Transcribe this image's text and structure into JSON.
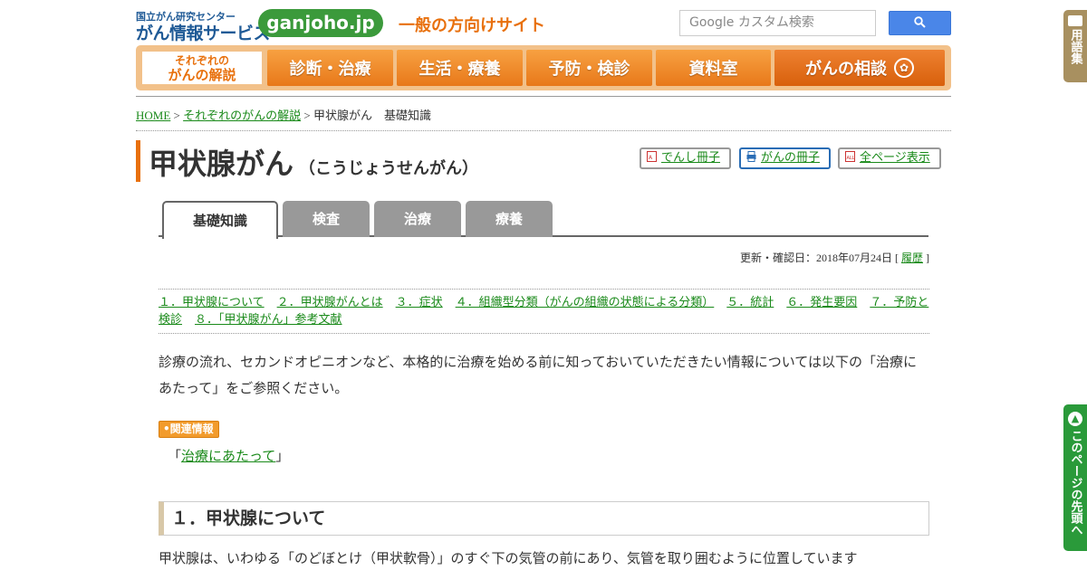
{
  "header": {
    "org": "国立がん研究センター",
    "service": "がん情報サービス",
    "domain": "ganjoho.jp",
    "tagline": "一般の方向けサイト",
    "search_placeholder": "Google カスタム検索"
  },
  "nav": {
    "active_l1": "それぞれの",
    "active_l2": "がんの解説",
    "items": [
      "診断・治療",
      "生活・療養",
      "予防・検診",
      "資料室",
      "がんの相談"
    ]
  },
  "breadcrumb": {
    "home": "HOME",
    "sep": " > ",
    "parent": "それぞれのがんの解説",
    "current": "甲状腺がん　基礎知識"
  },
  "page": {
    "title": "甲状腺がん",
    "reading": "（こうじょうせんがん）"
  },
  "tools": {
    "ebook": "でんし冊子",
    "booklet": "がんの冊子",
    "allpages": "全ページ表示"
  },
  "tabs": [
    "基礎知識",
    "検査",
    "治療",
    "療養"
  ],
  "updated": {
    "label": "更新・確認日：2018年07月24日 [ ",
    "history": "履歴",
    "close": " ]"
  },
  "toc": [
    "１．甲状腺について",
    "２．甲状腺がんとは",
    "３．症状",
    "４．組織型分類（がんの組織の状態による分類）",
    "５．統計",
    "６．発生要因",
    "７．予防と検診",
    "８．「甲状腺がん」参考文献"
  ],
  "intro": "診療の流れ、セカンドオピニオンなど、本格的に治療を始める前に知っておいていただきたい情報については以下の「治療にあたって」をご参照ください。",
  "related": {
    "badge": "関連情報",
    "open": "「",
    "link": "治療にあたって",
    "close": "」"
  },
  "section1": {
    "heading": "１．甲状腺について",
    "body": "甲状腺は、いわゆる「のどぼとけ（甲状軟骨）」のすぐ下の気管の前にあり、気管を取り囲むように位置しています"
  },
  "side": {
    "glossary": "用語集",
    "to_top": "このページの先頭へ"
  },
  "colors": {
    "nav_orange": "#e8781a",
    "link_green": "#1a8a1a",
    "brand_blue": "#1f5a96",
    "side_green": "#2a9a3a",
    "side_brown": "#a89060"
  }
}
